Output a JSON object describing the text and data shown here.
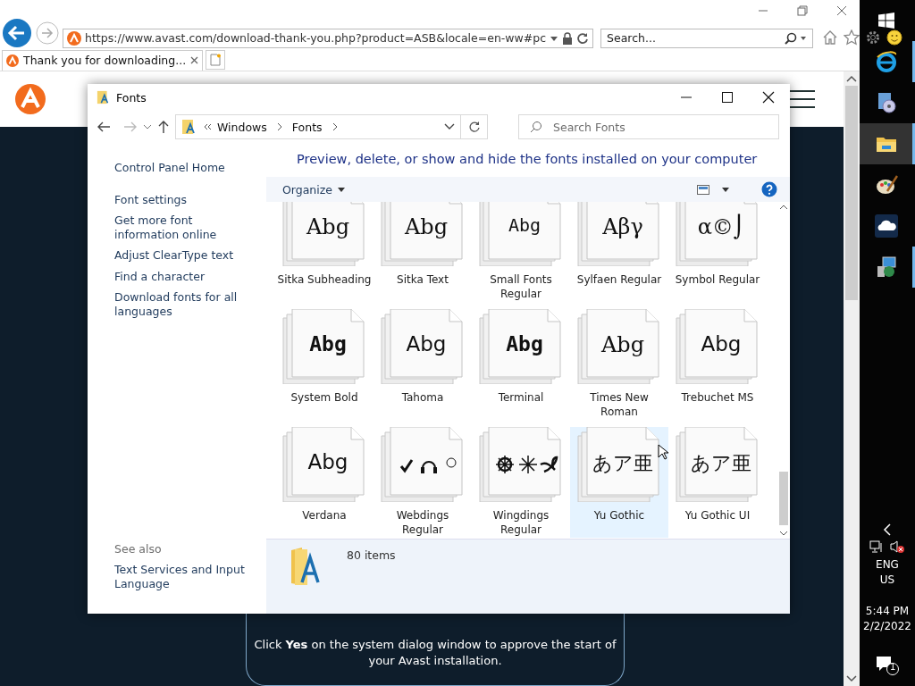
{
  "browser": {
    "address": "https://www.avast.com/download-thank-you.php?product=ASB&locale=en-ww#pc",
    "search": {
      "placeholder": "Search..."
    },
    "tabs": [
      {
        "label": "Thank you for downloading...",
        "selected": true
      }
    ],
    "page": {
      "card_text": "Click **Yes** on the system dialog window to approve the start of your Avast installation."
    }
  },
  "fonts_window": {
    "title": "Fonts",
    "breadcrumb": [
      "Windows",
      "Fonts"
    ],
    "search": {
      "placeholder": "Search Fonts"
    },
    "sidebar": {
      "links": [
        "Control Panel Home",
        "Font settings",
        "Get more font information online",
        "Adjust ClearType text",
        "Find a character",
        "Download fonts for all languages"
      ],
      "see_also": {
        "heading": "See also",
        "links": [
          "Text Services and Input Language"
        ]
      }
    },
    "heading": "Preview, delete, or show and hide the fonts installed on your computer",
    "toolbar": {
      "organize": "Organize"
    },
    "items": [
      {
        "name": "Sitka Subheading",
        "kind": "serif",
        "preview": "Abg",
        "selected": false
      },
      {
        "name": "Sitka Text",
        "kind": "serif",
        "preview": "Abg",
        "selected": false
      },
      {
        "name": "Small Fonts Regular",
        "kind": "bitmap",
        "preview": "Abg",
        "selected": false
      },
      {
        "name": "Sylfaen Regular",
        "kind": "serif",
        "preview": "Aβγ",
        "selected": false
      },
      {
        "name": "Symbol Regular",
        "kind": "serif",
        "preview": "α©⌡",
        "selected": false
      },
      {
        "name": "System Bold",
        "kind": "bold",
        "preview": "Abg",
        "selected": false
      },
      {
        "name": "Tahoma",
        "kind": "sans",
        "preview": "Abg",
        "selected": false
      },
      {
        "name": "Terminal",
        "kind": "bold",
        "preview": "Abg",
        "selected": false
      },
      {
        "name": "Times New Roman",
        "kind": "serif",
        "preview": "Abg",
        "selected": false
      },
      {
        "name": "Trebuchet MS",
        "kind": "sans",
        "preview": "Abg",
        "selected": false
      },
      {
        "name": "Verdana",
        "kind": "sans",
        "preview": "Abg",
        "selected": false
      },
      {
        "name": "Webdings Regular",
        "kind": "webdings",
        "selected": false
      },
      {
        "name": "Wingdings Regular",
        "kind": "wingdings",
        "selected": false
      },
      {
        "name": "Yu Gothic",
        "kind": "cjk",
        "preview": "あア亜",
        "selected": true
      },
      {
        "name": "Yu Gothic UI",
        "kind": "cjk",
        "preview": "あア亜",
        "selected": false
      }
    ],
    "status": "80 items"
  },
  "taskbar": {
    "language": [
      "ENG",
      "US"
    ],
    "time": "5:44 PM",
    "date": "2/2/2022",
    "notifications": "1"
  }
}
